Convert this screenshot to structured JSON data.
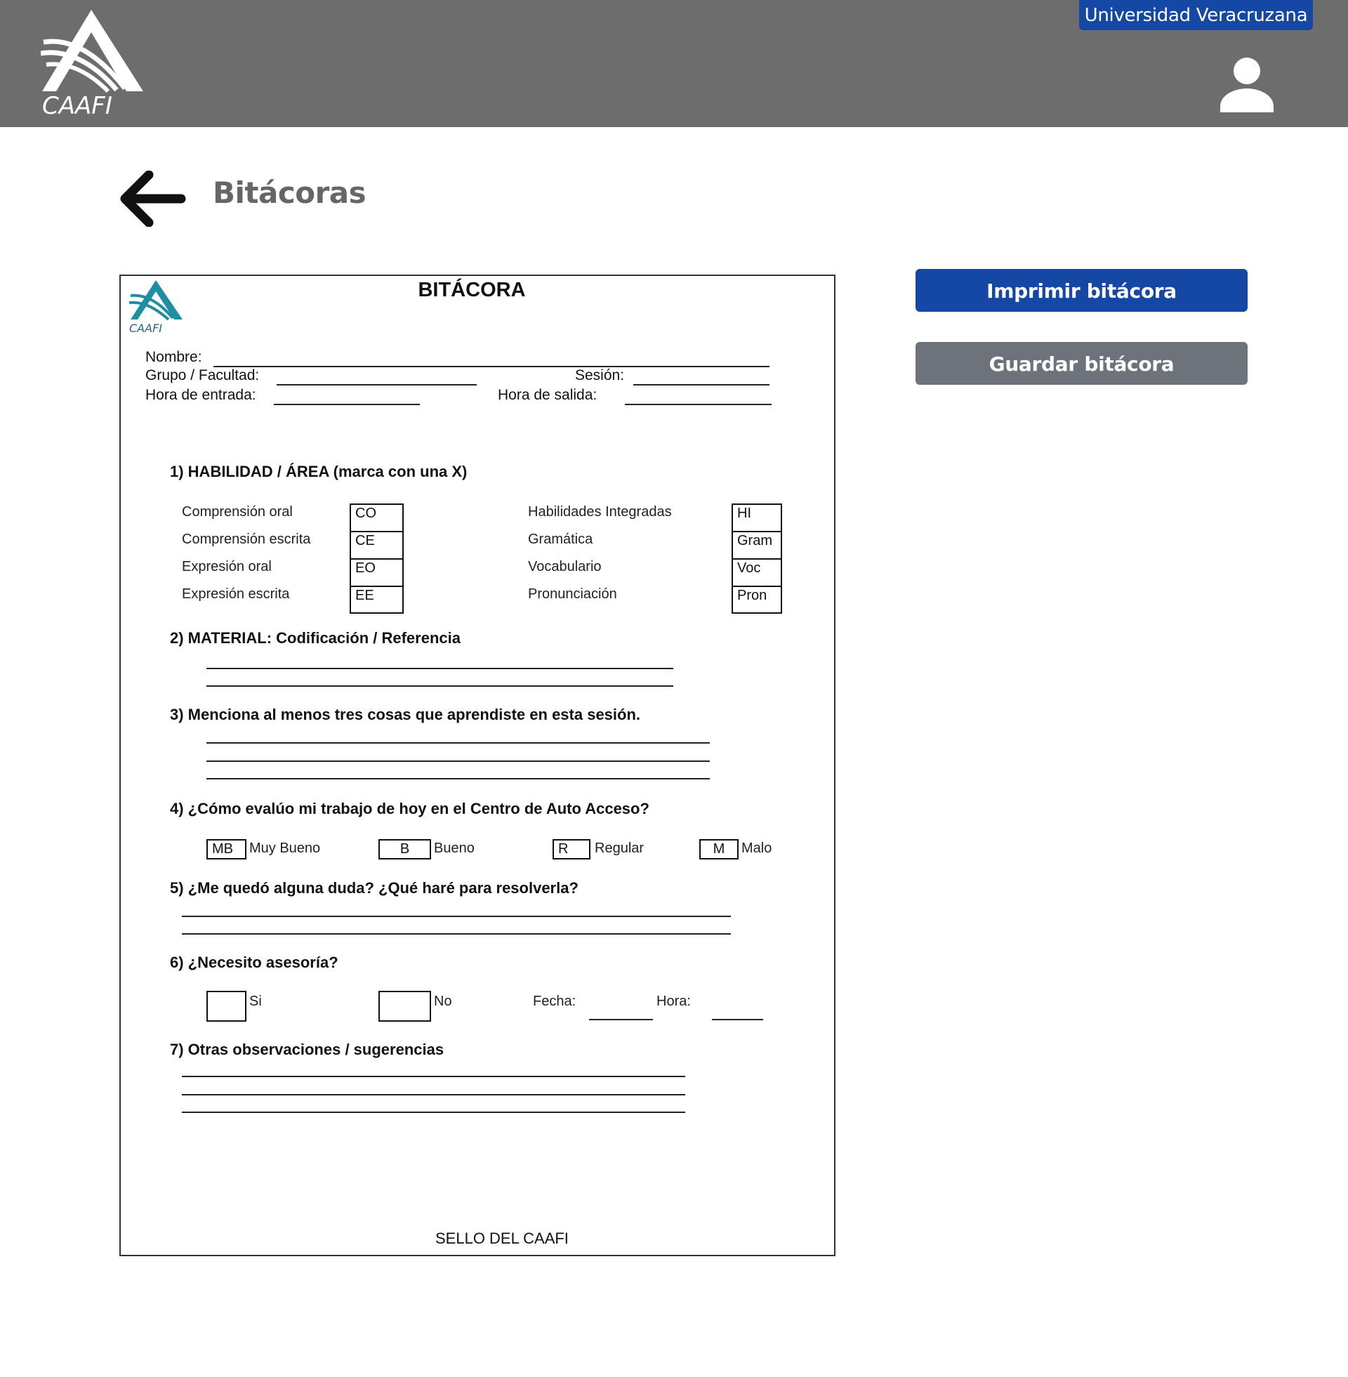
{
  "header": {
    "brand": "CAAFI",
    "university_badge": "Universidad Veracruzana",
    "colors": {
      "bar": "#6d6d6d",
      "badge": "#1547a5"
    }
  },
  "page": {
    "title": "Bitácoras"
  },
  "actions": {
    "print_label": "Imprimir bitácora",
    "save_label": "Guardar bitácora",
    "colors": {
      "print": "#1547a5",
      "save": "#6d727b"
    }
  },
  "document": {
    "logo_text": "CAAFI",
    "title": "BITÁCORA",
    "fields": {
      "nombre": "Nombre:",
      "grupo": "Grupo / Facultad:",
      "sesion": "Sesión:",
      "hora_entrada": "Hora de entrada:",
      "hora_salida": "Hora de salida:"
    },
    "q1": {
      "title": "1)  HABILIDAD / ÁREA (marca con una X)",
      "left": [
        {
          "label": "Comprensión oral",
          "code": "CO"
        },
        {
          "label": "Comprensión escrita",
          "code": "CE"
        },
        {
          "label": "Expresión oral",
          "code": "EO"
        },
        {
          "label": "Expresión escrita",
          "code": "EE"
        }
      ],
      "right": [
        {
          "label": "Habilidades Integradas",
          "code": "HI"
        },
        {
          "label": "Gramática",
          "code": "Gram"
        },
        {
          "label": "Vocabulario",
          "code": "Voc"
        },
        {
          "label": "Pronunciación",
          "code": "Pron"
        }
      ]
    },
    "q2": {
      "title": "2)  MATERIAL: Codificación / Referencia"
    },
    "q3": {
      "title": "3)  Menciona al menos tres cosas que aprendiste en esta sesión."
    },
    "q4": {
      "title": "4) ¿Cómo evalúo mi trabajo de hoy en el Centro de Auto Acceso?",
      "options": [
        {
          "code": "MB",
          "label": "Muy Bueno"
        },
        {
          "code": "B",
          "label": "Bueno"
        },
        {
          "code": "R",
          "label": "Regular"
        },
        {
          "code": "M",
          "label": "Malo"
        }
      ]
    },
    "q5": {
      "title": "5) ¿Me quedó alguna duda? ¿Qué haré para resolverla?"
    },
    "q6": {
      "title": "6) ¿Necesito asesoría?",
      "si": "Si",
      "no": "No",
      "fecha": "Fecha:",
      "hora": "Hora:"
    },
    "q7": {
      "title": "7) Otras observaciones / sugerencias"
    },
    "seal": "SELLO DEL CAAFI"
  },
  "icons": {
    "logo": "caafi-logo-icon",
    "user": "user-icon",
    "back": "arrow-left-icon"
  }
}
